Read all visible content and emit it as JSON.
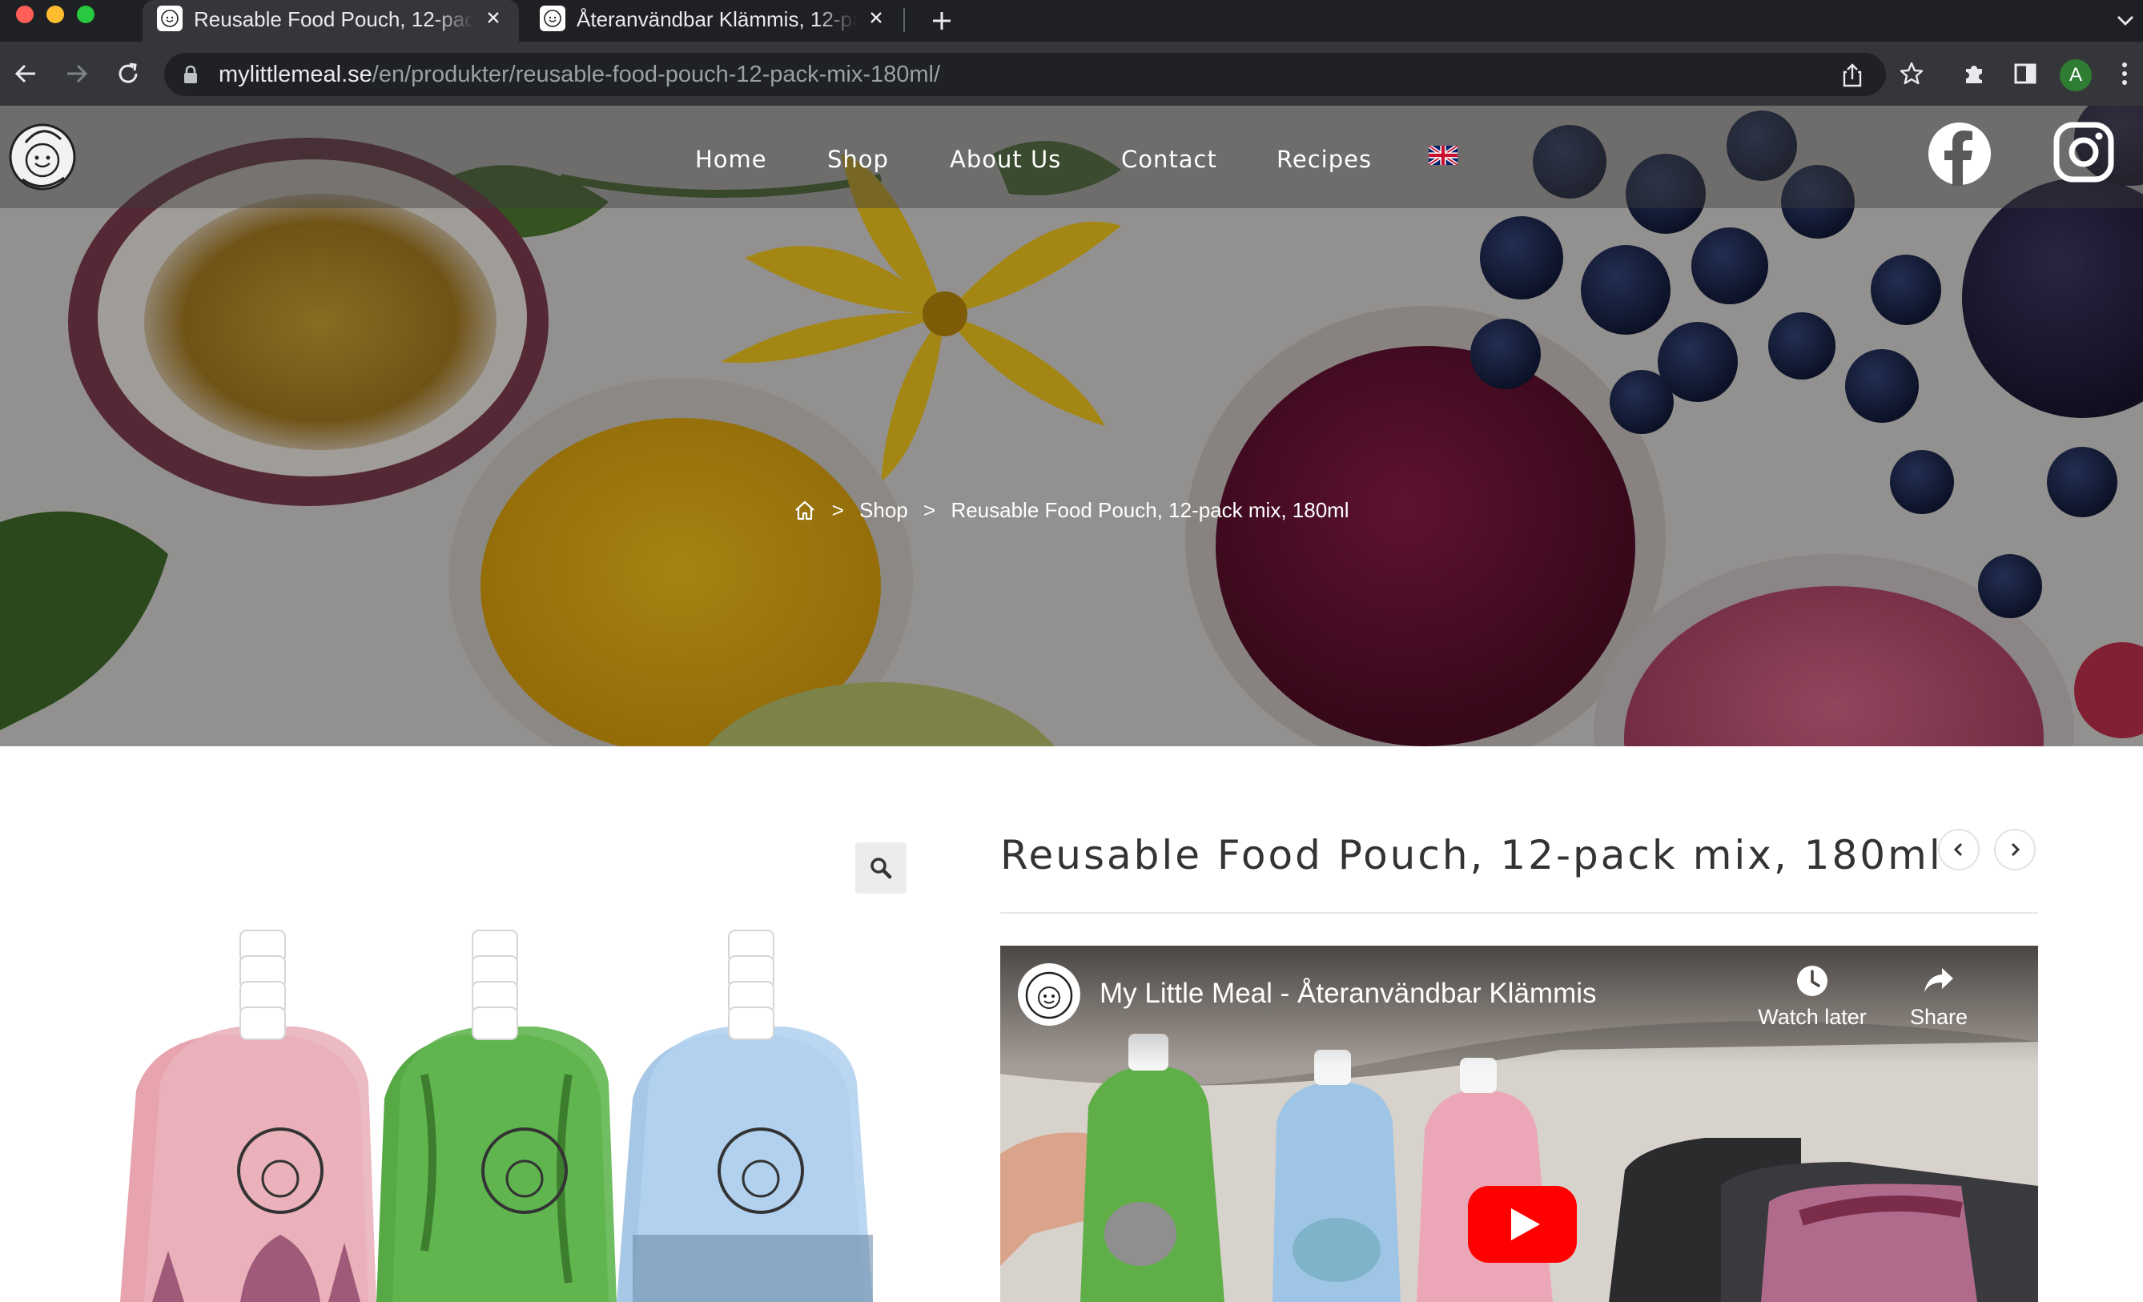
{
  "browser": {
    "tabs": [
      {
        "title": "Reusable Food Pouch, 12-pack mix, 180ml",
        "active": true
      },
      {
        "title": "Återanvändbar Klämmis, 12-pack mix, 180ml",
        "active": false
      }
    ],
    "url_host": "mylittlemeal.se",
    "url_path": "/en/produkter/reusable-food-pouch-12-pack-mix-180ml/",
    "profile_initial": "A",
    "colors": {
      "tabbar": "#1f2023",
      "toolbar": "#35363a",
      "omnibox": "#202124",
      "profile": "#2e7d32"
    }
  },
  "site": {
    "nav": [
      {
        "label": "Home"
      },
      {
        "label": "Shop"
      },
      {
        "label": "About Us"
      },
      {
        "label": "Contact"
      },
      {
        "label": "Recipes"
      }
    ],
    "language_flag": "uk-flag",
    "social": [
      "facebook-icon",
      "instagram-icon"
    ]
  },
  "breadcrumb": {
    "shop": "Shop",
    "current": "Reusable Food Pouch, 12-pack mix, 180ml",
    "separator": ">"
  },
  "product": {
    "title": "Reusable Food Pouch, 12-pack mix, 180ml",
    "pouch_colors": [
      "#e8a8b2",
      "#5bb04a",
      "#a9cbe8"
    ]
  },
  "video": {
    "title": "My Little Meal - Återanvändbar Klämmis",
    "watch_later": "Watch later",
    "share": "Share"
  }
}
